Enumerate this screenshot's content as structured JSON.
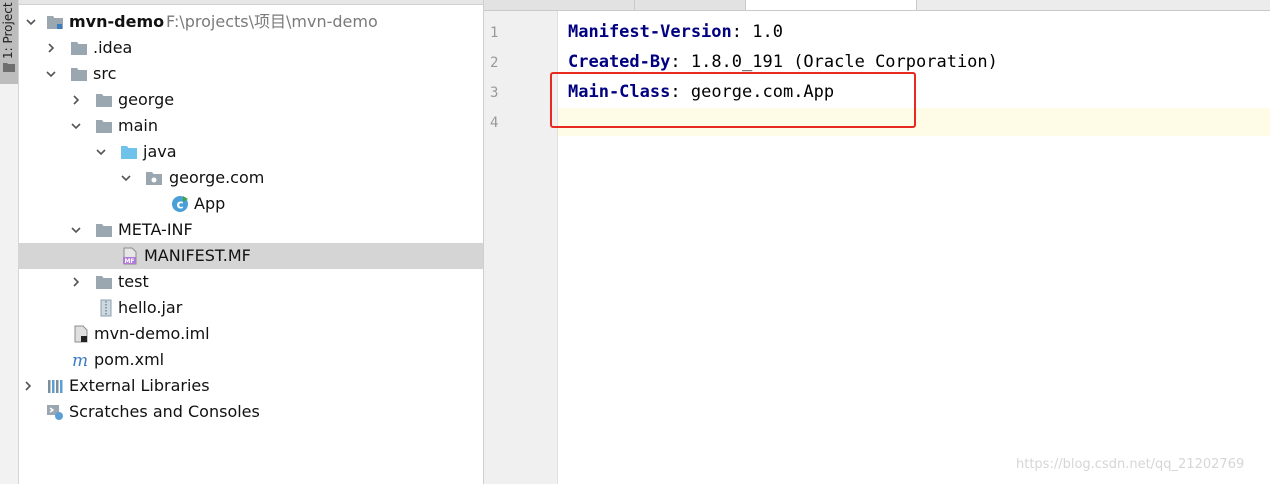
{
  "sidebar": {
    "tab_label": "1: Project"
  },
  "tree": {
    "root_name": "mvn-demo",
    "root_path": "F:\\projects\\项目\\mvn-demo",
    "nodes": {
      "idea": ".idea",
      "src": "src",
      "george": "george",
      "main": "main",
      "java": "java",
      "george_com": "george.com",
      "app": "App",
      "meta_inf": "META-INF",
      "manifest": "MANIFEST.MF",
      "test": "test",
      "hello_jar": "hello.jar",
      "iml": "mvn-demo.iml",
      "pom": "pom.xml",
      "ext_libs": "External Libraries",
      "scratches": "Scratches and Consoles"
    }
  },
  "editor": {
    "line_numbers": [
      "1",
      "2",
      "3",
      "4"
    ],
    "lines": [
      {
        "key": "Manifest-Version",
        "sep": ": ",
        "value": "1.0"
      },
      {
        "key": "Created-By",
        "sep": ": ",
        "value": "1.8.0_191 (Oracle Corporation)"
      },
      {
        "key": "Main-Class",
        "sep": ": ",
        "value": "george.com.App"
      }
    ]
  },
  "watermark": "https://blog.csdn.net/qq_21202769",
  "colors": {
    "highlight": "#e8291f",
    "key": "#000080",
    "selection": "#d5d5d5",
    "caret_line": "#fefbe6"
  }
}
